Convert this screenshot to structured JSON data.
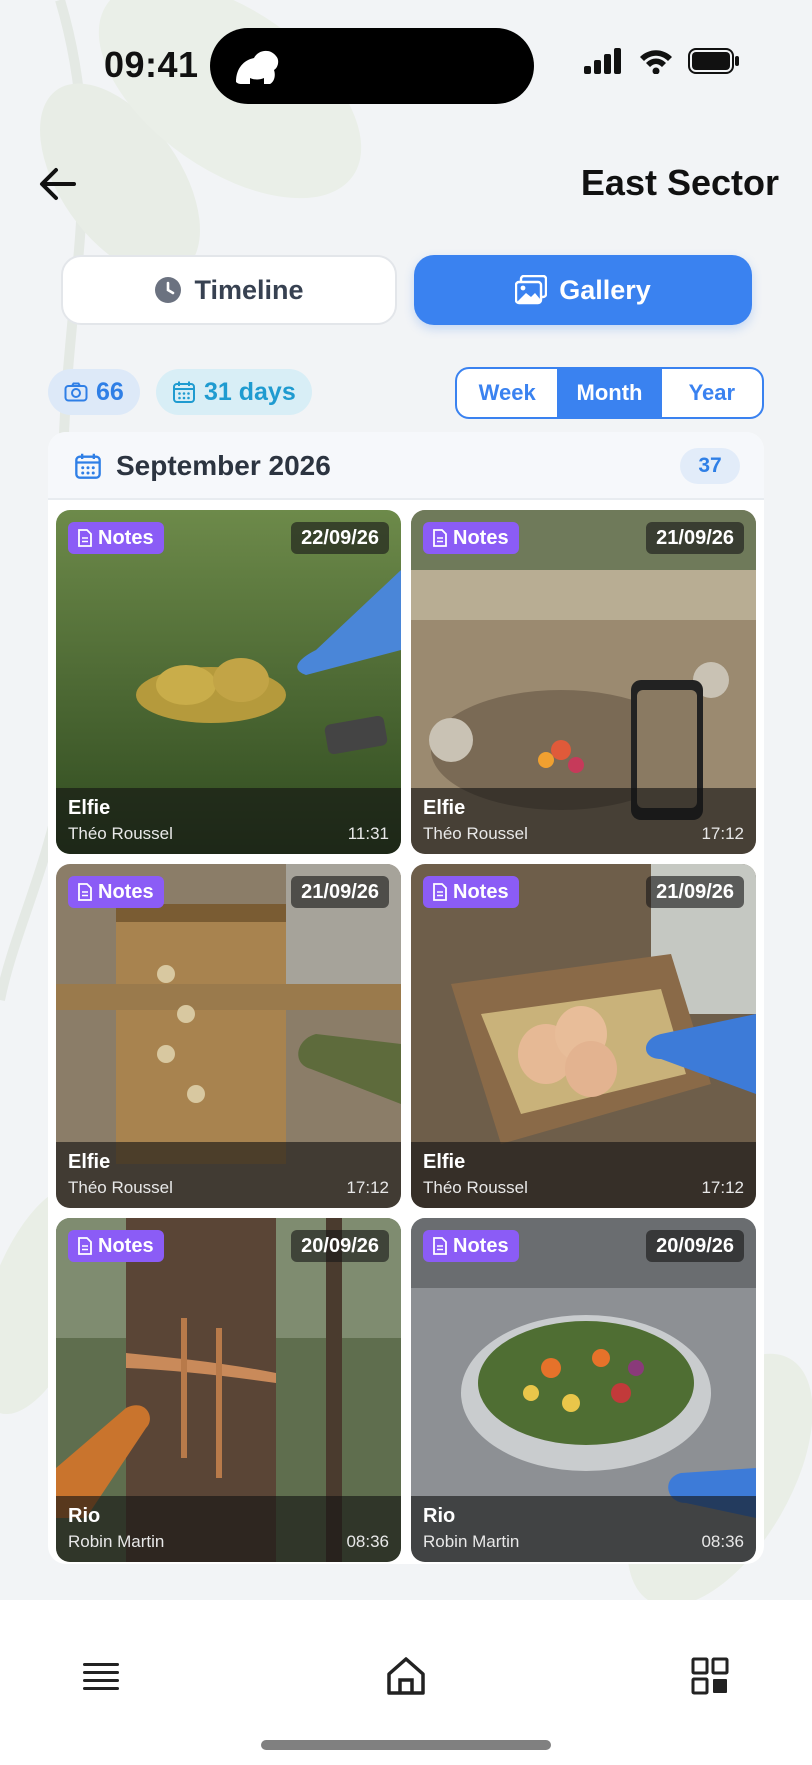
{
  "status_bar": {
    "time": "09:41"
  },
  "header": {
    "title": "East Sector"
  },
  "view_toggle": {
    "timeline_label": "Timeline",
    "gallery_label": "Gallery",
    "active": "gallery"
  },
  "stats": {
    "photos": "66",
    "days": "31 days"
  },
  "range": {
    "options": [
      "Week",
      "Month",
      "Year"
    ],
    "active": "Month"
  },
  "month": {
    "title": "September 2026",
    "count": "37"
  },
  "cards": [
    {
      "badge": "Notes",
      "date": "22/09/26",
      "animal": "Elfie",
      "author": "Théo Roussel",
      "time": "11:31",
      "scene": "gloved finger pointing at droppings on grass"
    },
    {
      "badge": "Notes",
      "date": "21/09/26",
      "animal": "Elfie",
      "author": "Théo Roussel",
      "time": "17:12",
      "scene": "enclosure with fruit on ground and phone"
    },
    {
      "badge": "Notes",
      "date": "21/09/26",
      "animal": "Elfie",
      "author": "Théo Roussel",
      "time": "17:12",
      "scene": "wooden puzzle feeder on fence"
    },
    {
      "badge": "Notes",
      "date": "21/09/26",
      "animal": "Elfie",
      "author": "Théo Roussel",
      "time": "17:12",
      "scene": "eggs in wooden nest box"
    },
    {
      "badge": "Notes",
      "date": "20/09/26",
      "animal": "Rio",
      "author": "Robin Martin",
      "time": "08:36",
      "scene": "claw marks on tree trunk"
    },
    {
      "badge": "Notes",
      "date": "20/09/26",
      "animal": "Rio",
      "author": "Robin Martin",
      "time": "08:36",
      "scene": "bowl of salad on steel counter"
    }
  ],
  "icons": {
    "back": "arrow-left-icon",
    "clock": "clock-icon",
    "gallery": "images-icon",
    "camera": "camera-icon",
    "calendar": "calendar-icon",
    "notes": "document-icon",
    "menu": "menu-icon",
    "home": "home-icon",
    "grid": "grid-icon"
  },
  "colors": {
    "accent": "#3a82f0",
    "notes_badge": "#8b5cf6"
  }
}
